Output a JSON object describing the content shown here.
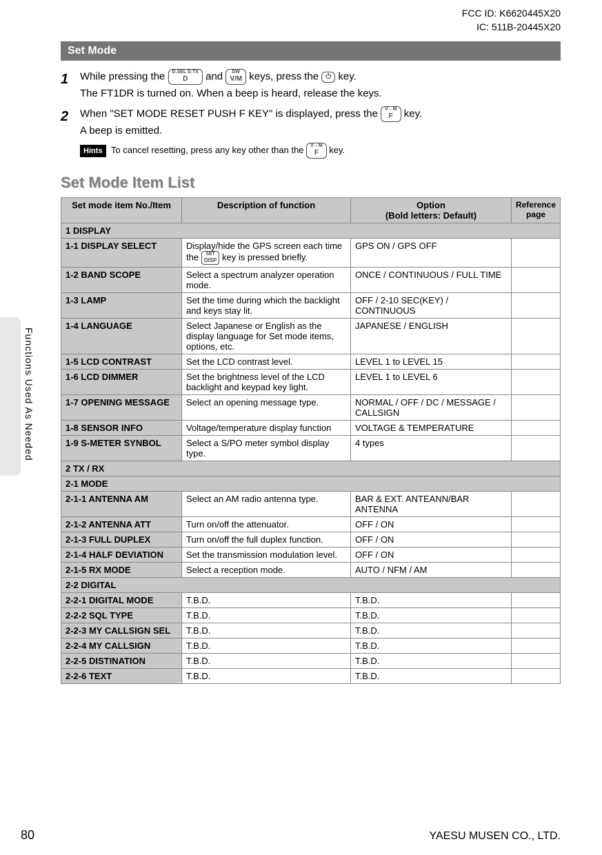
{
  "header": {
    "fcc": "FCC ID: K6620445X20",
    "ic": "IC: 511B-20445X20"
  },
  "sectionBar": "Set Mode",
  "steps": [
    {
      "num": "1",
      "lines": [
        "While pressing the [D] and [V/M] keys, press the [PWR] key.",
        "The FT1DR is turned on. When a beep is heard, release the keys."
      ],
      "key1_top": "D.SEL D.TX",
      "key1": "D",
      "key2_top": "DW",
      "key2": "V/M",
      "key3": "⏻"
    },
    {
      "num": "2",
      "lines": [
        "When \"SET MODE RESET PUSH F KEY\" is displayed, press the [F] key.",
        "A beep is emitted."
      ],
      "key4_top": "V↔M",
      "key4": "F"
    }
  ],
  "hints": {
    "badge": "Hints",
    "text": "To cancel resetting, press any key other than the [F] key.",
    "key_top": "V↔M",
    "key": "F"
  },
  "listTitle": "Set Mode Item List",
  "tableHeaders": {
    "col1": "Set mode item No./Item",
    "col2": "Description of function",
    "col3_l1": "Option",
    "col3_l2": "(Bold letters: Default)",
    "col4_l1": "Reference",
    "col4_l2": "page"
  },
  "dispKey": {
    "top": "SET",
    "label": "DISP"
  },
  "rows": [
    {
      "type": "section",
      "label": "1 DISPLAY"
    },
    {
      "type": "item",
      "name": "1-1 DISPLAY SELECT",
      "desc_pre": "Display/hide the GPS screen each time the ",
      "desc_post": " key is pressed briefly.",
      "hasDispKey": true,
      "option": "GPS ON / GPS OFF",
      "ref": ""
    },
    {
      "type": "item",
      "name": "1-2 BAND SCOPE",
      "desc": "Select a spectrum analyzer operation mode.",
      "option": "ONCE / CONTINUOUS / FULL TIME",
      "ref": ""
    },
    {
      "type": "item",
      "name": "1-3 LAMP",
      "desc": "Set the time during which the backlight and keys stay lit.",
      "option": "OFF / 2-10 SEC(KEY) / CONTINUOUS",
      "ref": ""
    },
    {
      "type": "item",
      "name": "1-4 LANGUAGE",
      "desc": "Select Japanese or English as the display language for Set mode items, options, etc.",
      "option": "JAPANESE / ENGLISH",
      "ref": ""
    },
    {
      "type": "item",
      "name": "1-5 LCD CONTRAST",
      "desc": "Set the LCD contrast level.",
      "option": "LEVEL 1 to LEVEL 15",
      "ref": ""
    },
    {
      "type": "item",
      "name": "1-6 LCD DIMMER",
      "desc": "Set the brightness level of the LCD backlight and keypad key light.",
      "option": "LEVEL 1 to LEVEL 6",
      "ref": ""
    },
    {
      "type": "item",
      "name": "1-7 OPENING MESSAGE",
      "desc": "Select an opening message type.",
      "option": "NORMAL / OFF / DC / MESSAGE / CALLSIGN",
      "ref": ""
    },
    {
      "type": "item",
      "name": "1-8 SENSOR INFO",
      "desc": "Voltage/temperature display function",
      "option": "VOLTAGE & TEMPERATURE",
      "ref": ""
    },
    {
      "type": "item",
      "name": "1-9 S-METER SYNBOL",
      "desc": "Select a S/PO meter symbol display type.",
      "option": "4 types",
      "ref": ""
    },
    {
      "type": "section",
      "label": "2 TX / RX"
    },
    {
      "type": "section",
      "label": "2-1 MODE"
    },
    {
      "type": "item",
      "name": "2-1-1 ANTENNA AM",
      "desc": "Select an AM radio antenna type.",
      "option": "BAR & EXT. ANTEANN/BAR ANTENNA",
      "ref": ""
    },
    {
      "type": "item",
      "name": "2-1-2 ANTENNA ATT",
      "desc": "Turn on/off the attenuator.",
      "option": "OFF / ON",
      "ref": ""
    },
    {
      "type": "item",
      "name": "2-1-3 FULL DUPLEX",
      "desc": "Turn on/off the full duplex function.",
      "option": "OFF / ON",
      "ref": ""
    },
    {
      "type": "item",
      "name": "2-1-4 HALF DEVIATION",
      "desc": "Set the transmission modulation level.",
      "option": "OFF / ON",
      "ref": ""
    },
    {
      "type": "item",
      "name": "2-1-5 RX MODE",
      "desc": "Select a reception mode.",
      "option": "AUTO / NFM / AM",
      "ref": ""
    },
    {
      "type": "section",
      "label": "2-2 DIGITAL"
    },
    {
      "type": "item",
      "name": "2-2-1 DIGITAL MODE",
      "desc": "T.B.D.",
      "option": "T.B.D.",
      "ref": ""
    },
    {
      "type": "item",
      "name": "2-2-2 SQL TYPE",
      "desc": "T.B.D.",
      "option": "T.B.D.",
      "ref": ""
    },
    {
      "type": "item",
      "name": "2-2-3 MY CALLSIGN SEL",
      "desc": "T.B.D.",
      "option": "T.B.D.",
      "ref": ""
    },
    {
      "type": "item",
      "name": "2-2-4 MY CALLSIGN",
      "desc": "T.B.D.",
      "option": "T.B.D.",
      "ref": ""
    },
    {
      "type": "item",
      "name": "2-2-5 DISTINATION",
      "desc": "T.B.D.",
      "option": "T.B.D.",
      "ref": ""
    },
    {
      "type": "item",
      "name": "2-2-6 TEXT",
      "desc": "T.B.D.",
      "option": "T.B.D.",
      "ref": ""
    }
  ],
  "sideTab": "Functions Used As Needed",
  "pageNum": "80",
  "footer": "YAESU MUSEN CO., LTD."
}
